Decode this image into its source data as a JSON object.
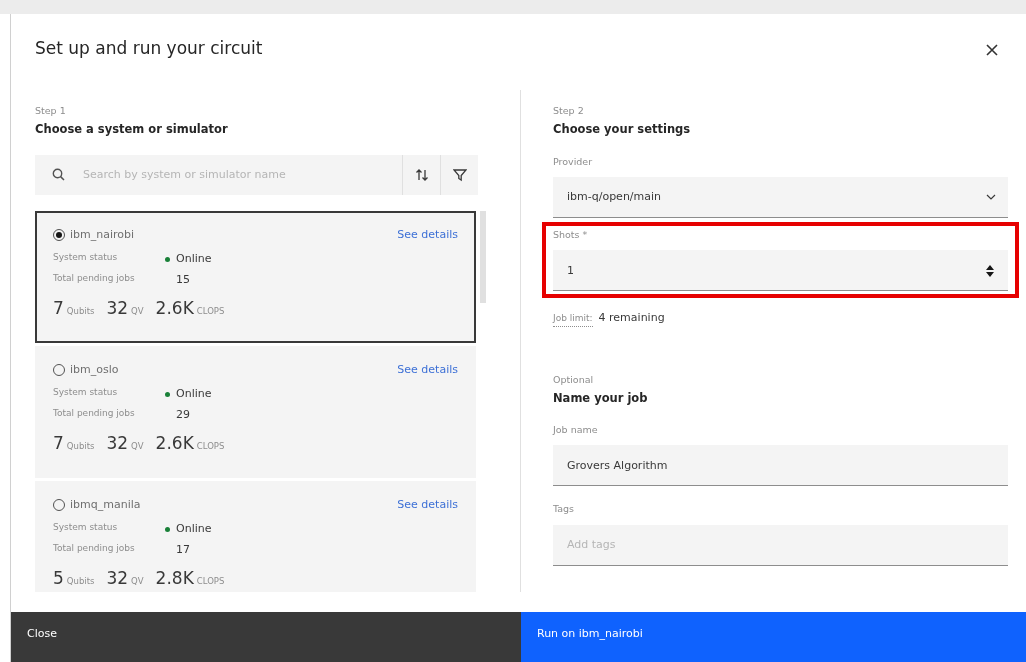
{
  "dialog": {
    "title": "Set up and run your circuit"
  },
  "step1": {
    "step": "Step 1",
    "heading": "Choose a system or simulator",
    "search": {
      "placeholder": "Search by system or simulator name"
    },
    "systems": [
      {
        "name": "ibm_nairobi",
        "selected": true,
        "link": "See details",
        "status_label": "System status",
        "status": "Online",
        "color": "#198038",
        "jobs_label": "Total pending jobs",
        "jobs": "15",
        "metrics": [
          {
            "value": "7",
            "unit": "Qubits"
          },
          {
            "value": "32",
            "unit": "QV"
          },
          {
            "value": "2.6K",
            "unit": "CLOPS"
          }
        ]
      },
      {
        "name": "ibm_oslo",
        "selected": false,
        "link": "See details",
        "status_label": "System status",
        "status": "Online",
        "color": "#198038",
        "jobs_label": "Total pending jobs",
        "jobs": "29",
        "metrics": [
          {
            "value": "7",
            "unit": "Qubits"
          },
          {
            "value": "32",
            "unit": "QV"
          },
          {
            "value": "2.6K",
            "unit": "CLOPS"
          }
        ]
      },
      {
        "name": "ibmq_manila",
        "selected": false,
        "link": "See details",
        "status_label": "System status",
        "status": "Online",
        "color": "#198038",
        "jobs_label": "Total pending jobs",
        "jobs": "17",
        "metrics": [
          {
            "value": "5",
            "unit": "Qubits"
          },
          {
            "value": "32",
            "unit": "QV"
          },
          {
            "value": "2.8K",
            "unit": "CLOPS"
          }
        ]
      }
    ]
  },
  "step2": {
    "step": "Step 2",
    "heading": "Choose your settings",
    "provider": {
      "label": "Provider",
      "value": "ibm-q/open/main"
    },
    "shots": {
      "label": "Shots *",
      "value": "1",
      "highlighted": true
    },
    "job_limit": {
      "label": "Job limit:",
      "value": "4 remaining"
    },
    "optional": "Optional",
    "job_heading": "Name your job",
    "job_name": {
      "label": "Job name",
      "value": "Grovers Algorithm"
    },
    "tags": {
      "label": "Tags",
      "placeholder": "Add tags"
    }
  },
  "footer": {
    "close": "Close",
    "run": "Run on ibm_nairobi"
  }
}
